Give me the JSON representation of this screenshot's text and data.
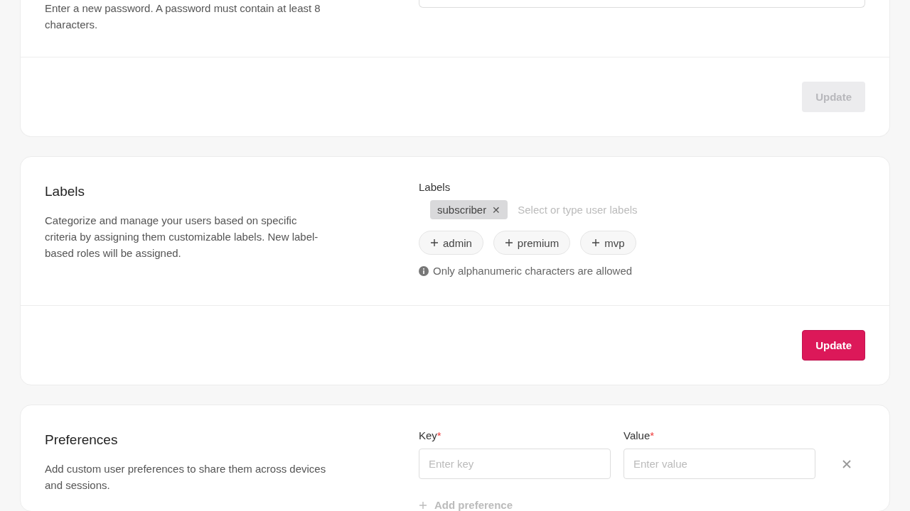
{
  "password_card": {
    "description": "Enter a new password. A password must contain at least 8 characters.",
    "update_button": {
      "label": "Update",
      "disabled": true
    }
  },
  "labels_card": {
    "title": "Labels",
    "description": "Categorize and manage your users based on specific criteria by assigning them customizable labels. New label-based roles will be assigned.",
    "field_label": "Labels",
    "selected_labels": [
      {
        "label": "subscriber",
        "remove_icon": "✕"
      }
    ],
    "placeholder": "Select or type user labels",
    "suggestions": [
      {
        "label": "admin"
      },
      {
        "label": "premium"
      },
      {
        "label": "mvp"
      }
    ],
    "hint": "Only alphanumeric characters are allowed",
    "update_button": {
      "label": "Update",
      "disabled": false
    }
  },
  "preferences_card": {
    "title": "Preferences",
    "description": "Add custom user preferences to share them across devices and sessions.",
    "key": {
      "label": "Key",
      "required_mark": "*",
      "placeholder": "Enter key"
    },
    "value": {
      "label": "Value",
      "required_mark": "*",
      "placeholder": "Enter value"
    },
    "add_button": {
      "label": "Add preference",
      "disabled": true
    }
  }
}
